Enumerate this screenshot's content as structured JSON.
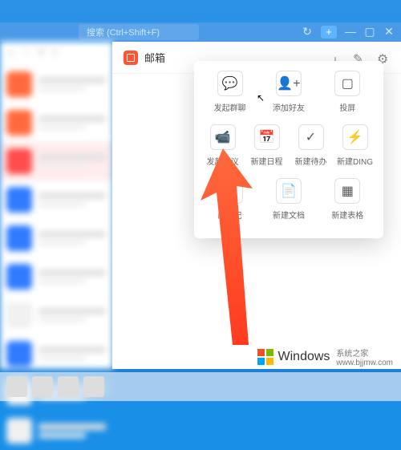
{
  "titlebar": {
    "search_placeholder": "搜索 (Ctrl+Shift+F)",
    "history_icon": "history-icon",
    "plus_label": "+",
    "minimize": "—",
    "maximize": "▢",
    "close": "✕"
  },
  "sidebar": {
    "tools": [
      "＋",
      "☆",
      "⟳",
      "≡"
    ],
    "items": [
      {
        "color": "o"
      },
      {
        "color": "o"
      },
      {
        "color": "r",
        "selected": true
      },
      {
        "color": "b"
      },
      {
        "color": "b"
      },
      {
        "color": "b"
      },
      {
        "color": "w"
      },
      {
        "color": "b"
      },
      {
        "color": "w"
      },
      {
        "color": "w"
      }
    ]
  },
  "main": {
    "title": "邮箱",
    "header_icons": [
      "plus-icon",
      "edit-icon",
      "settings-icon"
    ]
  },
  "popup": {
    "rows": [
      [
        {
          "label": "发起群聊",
          "icon": "chat-icon"
        },
        {
          "label": "添加好友",
          "icon": "add-friend-icon"
        },
        {
          "label": "投屏",
          "icon": "cast-icon"
        }
      ],
      [
        {
          "label": "发起会议",
          "icon": "video-icon"
        },
        {
          "label": "新建日程",
          "icon": "calendar-icon"
        },
        {
          "label": "新建待办",
          "icon": "todo-icon"
        },
        {
          "label": "新建DING",
          "icon": "ding-icon"
        }
      ],
      [
        {
          "label": "脑闪记",
          "icon": "note-icon"
        },
        {
          "label": "新建文档",
          "icon": "doc-icon"
        },
        {
          "label": "新建表格",
          "icon": "sheet-icon"
        }
      ]
    ]
  },
  "watermark": {
    "brand": "Windows",
    "sub1": "系统之家",
    "sub2": "www.bjjmw.com"
  },
  "colors": {
    "accent": "#ff5530",
    "desktop": "#1a8fe8"
  }
}
